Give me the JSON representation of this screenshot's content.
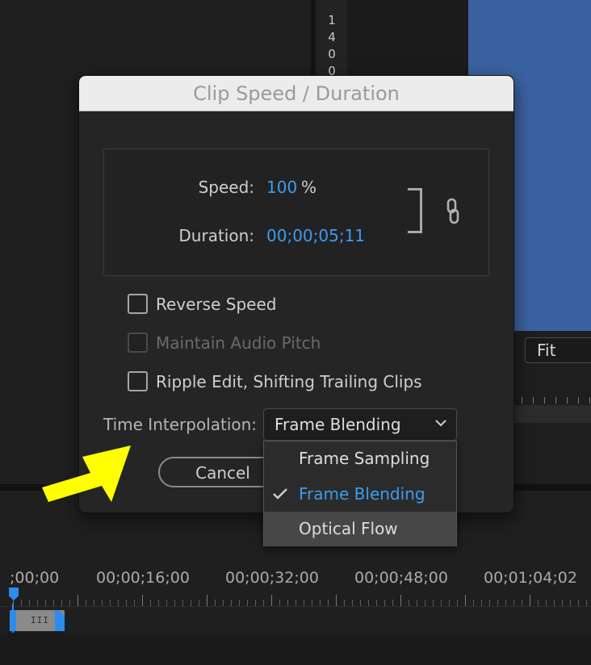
{
  "background": {
    "ruler_digits": [
      "1",
      "4",
      "0",
      "0"
    ],
    "fit_dropdown_value": "Fit"
  },
  "timeline": {
    "timecodes": [
      ";00;00",
      "00;00;16;00",
      "00;00;32;00",
      "00;00;48;00",
      "00;01;04;02"
    ],
    "clip_grip": "III"
  },
  "dialog": {
    "title": "Clip Speed / Duration",
    "speed_label": "Speed:",
    "speed_value": "100",
    "speed_unit": "%",
    "duration_label": "Duration:",
    "duration_value": "00;00;05;11",
    "checkboxes": [
      {
        "label": "Reverse Speed",
        "checked": false,
        "enabled": true
      },
      {
        "label": "Maintain Audio Pitch",
        "checked": false,
        "enabled": false
      },
      {
        "label": "Ripple Edit, Shifting Trailing Clips",
        "checked": false,
        "enabled": true
      }
    ],
    "time_interpolation_label": "Time Interpolation:",
    "time_interpolation_value": "Frame Blending",
    "cancel_label": "Cancel"
  },
  "menu": {
    "items": [
      {
        "label": "Frame Sampling",
        "checked": false
      },
      {
        "label": "Frame Blending",
        "checked": true
      },
      {
        "label": "Optical Flow",
        "checked": false,
        "hovered": true
      }
    ]
  },
  "colors": {
    "accent_blue": "#3b9df0",
    "annotation_arrow": "#ffff00",
    "video_preview": "#3b62a0"
  }
}
